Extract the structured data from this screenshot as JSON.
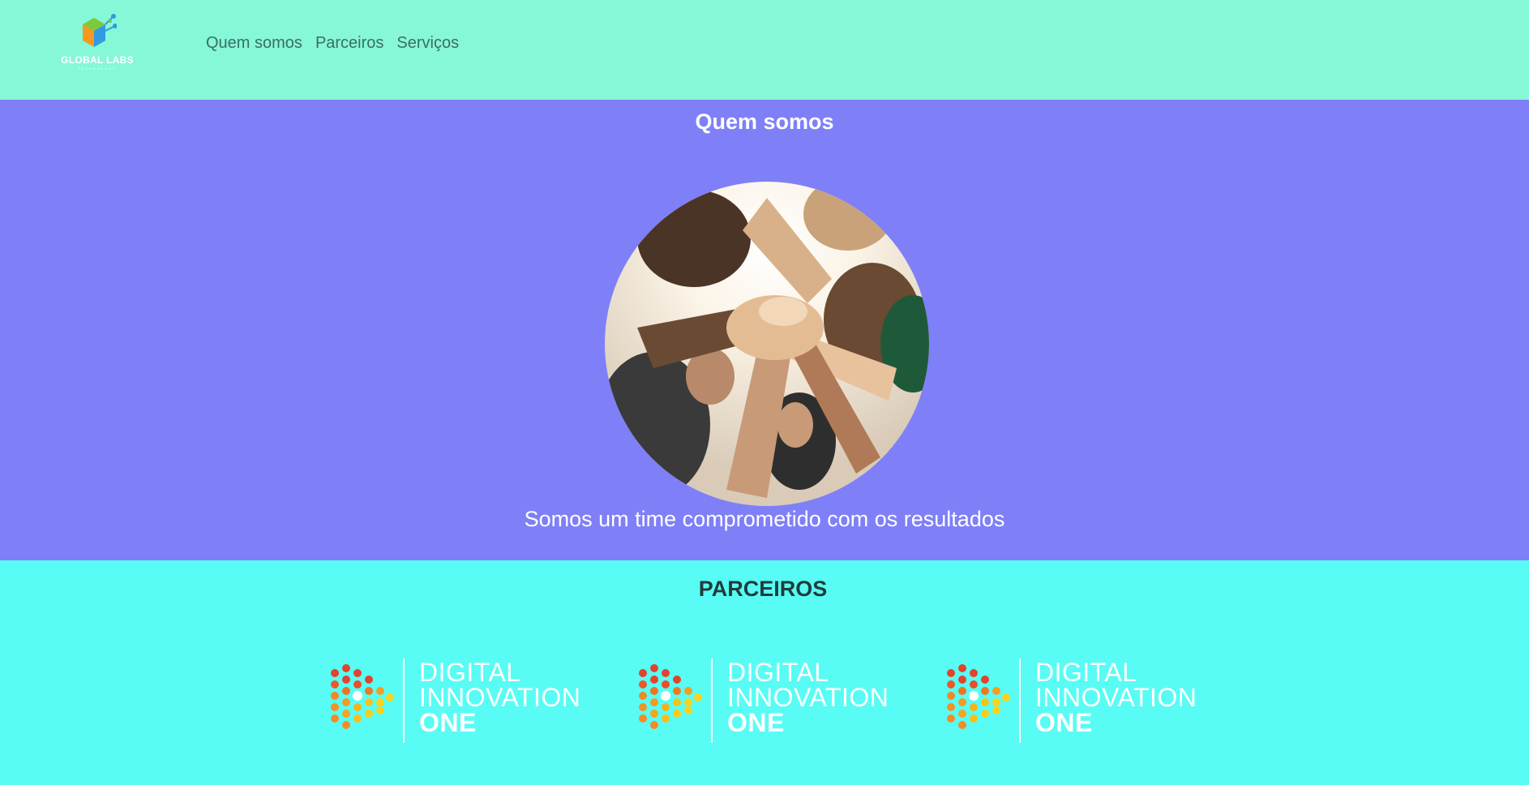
{
  "header": {
    "logo": {
      "name": "GLOBAL LABS",
      "tagline": "TECHNOLOGY",
      "icon": "cube-network-icon"
    },
    "nav": [
      {
        "label": "Quem somos"
      },
      {
        "label": "Parceiros"
      },
      {
        "label": "Serviços"
      }
    ]
  },
  "about": {
    "title": "Quem somos",
    "image": "team-hands-together-photo",
    "text": "Somos um time comprometido com os resultados"
  },
  "partners": {
    "title": "PARCEIROS",
    "logos": [
      {
        "line1": "DIGITAL",
        "line2": "INNOVATION",
        "line3": "ONE"
      },
      {
        "line1": "DIGITAL",
        "line2": "INNOVATION",
        "line3": "ONE"
      },
      {
        "line1": "DIGITAL",
        "line2": "INNOVATION",
        "line3": "ONE"
      }
    ]
  },
  "colors": {
    "header_bg": "#86f7d7",
    "about_bg": "#7f80f7",
    "partners_bg": "#59fcf4",
    "nav_text": "#3b6e66"
  }
}
